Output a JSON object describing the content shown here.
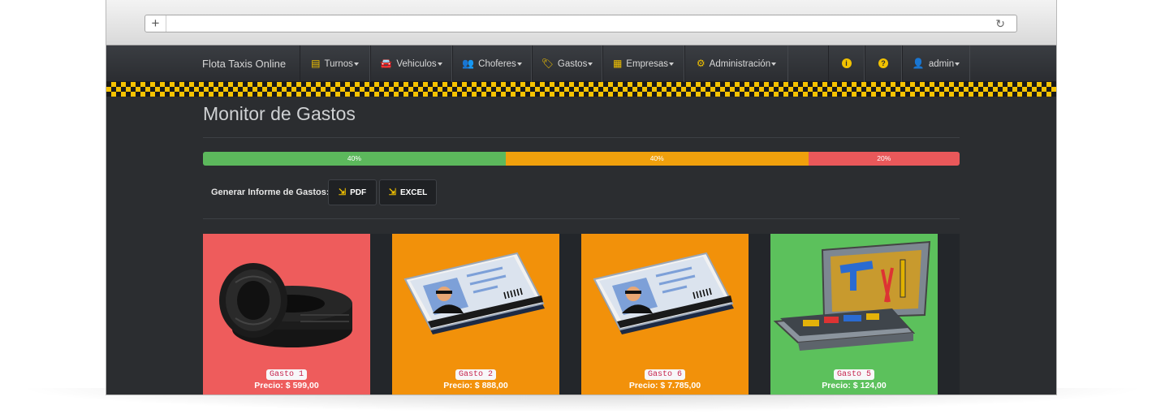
{
  "browser": {
    "plus_label": "+",
    "reload_label": "↻"
  },
  "navbar": {
    "brand": "Flota Taxis Online",
    "menus": [
      {
        "label": "Turnos",
        "icon": "calendar-icon",
        "glyph": "▤"
      },
      {
        "label": "Vehiculos",
        "icon": "car-icon",
        "glyph": "🚘"
      },
      {
        "label": "Choferes",
        "icon": "users-icon",
        "glyph": "👥"
      },
      {
        "label": "Gastos",
        "icon": "wallet-icon",
        "glyph": "🏷"
      },
      {
        "label": "Empresas",
        "icon": "building-icon",
        "glyph": "▦"
      },
      {
        "label": "Administración",
        "icon": "settings-icon",
        "glyph": "⚙"
      }
    ],
    "info_glyph": "i",
    "help_glyph": "?",
    "user": {
      "label": "admin",
      "icon": "user-icon",
      "glyph": "👤"
    }
  },
  "page": {
    "title": "Monitor de Gastos",
    "progress": [
      {
        "label": "40%",
        "value": 40,
        "color": "#5cb85c"
      },
      {
        "label": "40%",
        "value": 40,
        "color": "#f0a00c"
      },
      {
        "label": "20%",
        "value": 20,
        "color": "#e9585a"
      }
    ],
    "report": {
      "label": "Generar Informe de Gastos:",
      "pdf": "PDF",
      "excel": "EXCEL",
      "download_glyph": "⇲"
    },
    "cards": [
      {
        "name": "Gasto 1",
        "price": "Precio: $ 599,00",
        "color": "#ee5c5c",
        "image": "tires-image"
      },
      {
        "name": "Gasto 2",
        "price": "Precio: $ 888,00",
        "color": "#f2910a",
        "image": "id-card-image"
      },
      {
        "name": "Gasto 6",
        "price": "Precio: $ 7.785,00",
        "color": "#f2910a",
        "image": "id-card-image"
      },
      {
        "name": "Gasto 5",
        "price": "Precio: $ 124,00",
        "color": "#5cc15c",
        "image": "toolbox-image"
      }
    ]
  }
}
